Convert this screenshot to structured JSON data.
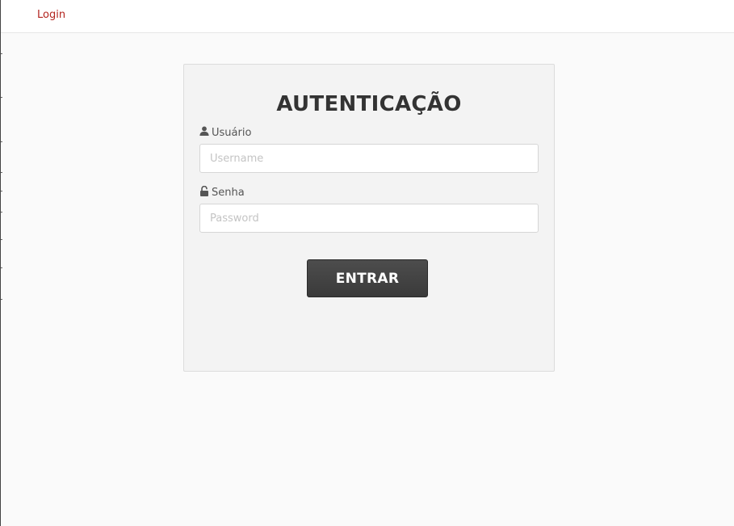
{
  "nav": {
    "login_link": "Login"
  },
  "login_form": {
    "title": "AUTENTICAÇÃO",
    "username": {
      "label": "Usuário",
      "icon": "user-icon",
      "value": "",
      "placeholder": "Username"
    },
    "password": {
      "label": "Senha",
      "icon": "unlock-icon",
      "value": "",
      "placeholder": "Password"
    },
    "submit_label": "ENTRAR"
  },
  "colors": {
    "link": "#b3241e",
    "button": "#444444",
    "panel": "#f3f3f3",
    "page_background": "#fafafa"
  }
}
